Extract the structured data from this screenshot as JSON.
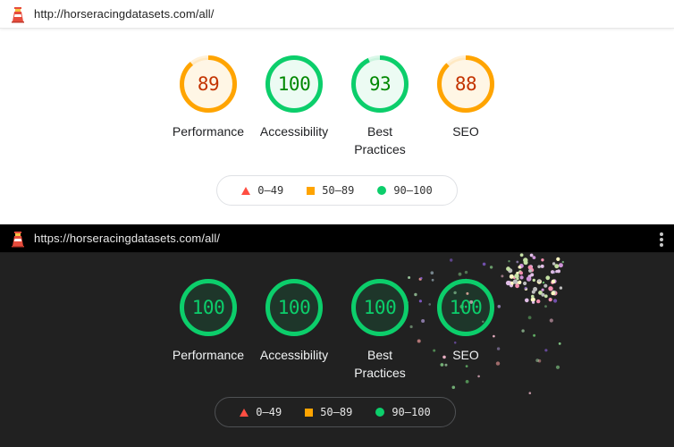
{
  "reports": [
    {
      "theme": "light",
      "url": "http://horseracingdatasets.com/all/",
      "scores": [
        {
          "label": "Performance",
          "value": "89",
          "score": 0.89,
          "status": "average"
        },
        {
          "label": "Accessibility",
          "value": "100",
          "score": 1.0,
          "status": "pass"
        },
        {
          "label": "Best Practices",
          "value": "93",
          "score": 0.93,
          "status": "pass"
        },
        {
          "label": "SEO",
          "value": "88",
          "score": 0.88,
          "status": "average"
        }
      ],
      "legend": [
        {
          "range": "0–49",
          "shape": "triangle"
        },
        {
          "range": "50–89",
          "shape": "square"
        },
        {
          "range": "90–100",
          "shape": "circle"
        }
      ]
    },
    {
      "theme": "dark",
      "url": "https://horseracingdatasets.com/all/",
      "scores": [
        {
          "label": "Performance",
          "value": "100",
          "score": 1.0,
          "status": "pass"
        },
        {
          "label": "Accessibility",
          "value": "100",
          "score": 1.0,
          "status": "pass"
        },
        {
          "label": "Best Practices",
          "value": "100",
          "score": 1.0,
          "status": "pass"
        },
        {
          "label": "SEO",
          "value": "100",
          "score": 1.0,
          "status": "pass"
        }
      ],
      "legend": [
        {
          "range": "0–49",
          "shape": "triangle"
        },
        {
          "range": "50–89",
          "shape": "square"
        },
        {
          "range": "90–100",
          "shape": "circle"
        }
      ]
    }
  ],
  "colors": {
    "pass": "#0cce6b",
    "pass_text": "#008800",
    "average": "#ffa400",
    "average_text": "#c33300",
    "fail": "#ff4e42",
    "pass_dark_text": "#0cce6b",
    "confetti": [
      "#bdbdbd",
      "#f48fb1",
      "#e1bee7",
      "#ce93d8",
      "#c5e1a5",
      "#fff9c4",
      "#b39ddb",
      "#81c784",
      "#90a4ae",
      "#f8bbd0",
      "#a5d6a7",
      "#7e57c2",
      "#66bb6a",
      "#ef9a9a"
    ]
  },
  "icons": {
    "app": "lighthouse-icon",
    "menu": "more-vert-icon"
  }
}
